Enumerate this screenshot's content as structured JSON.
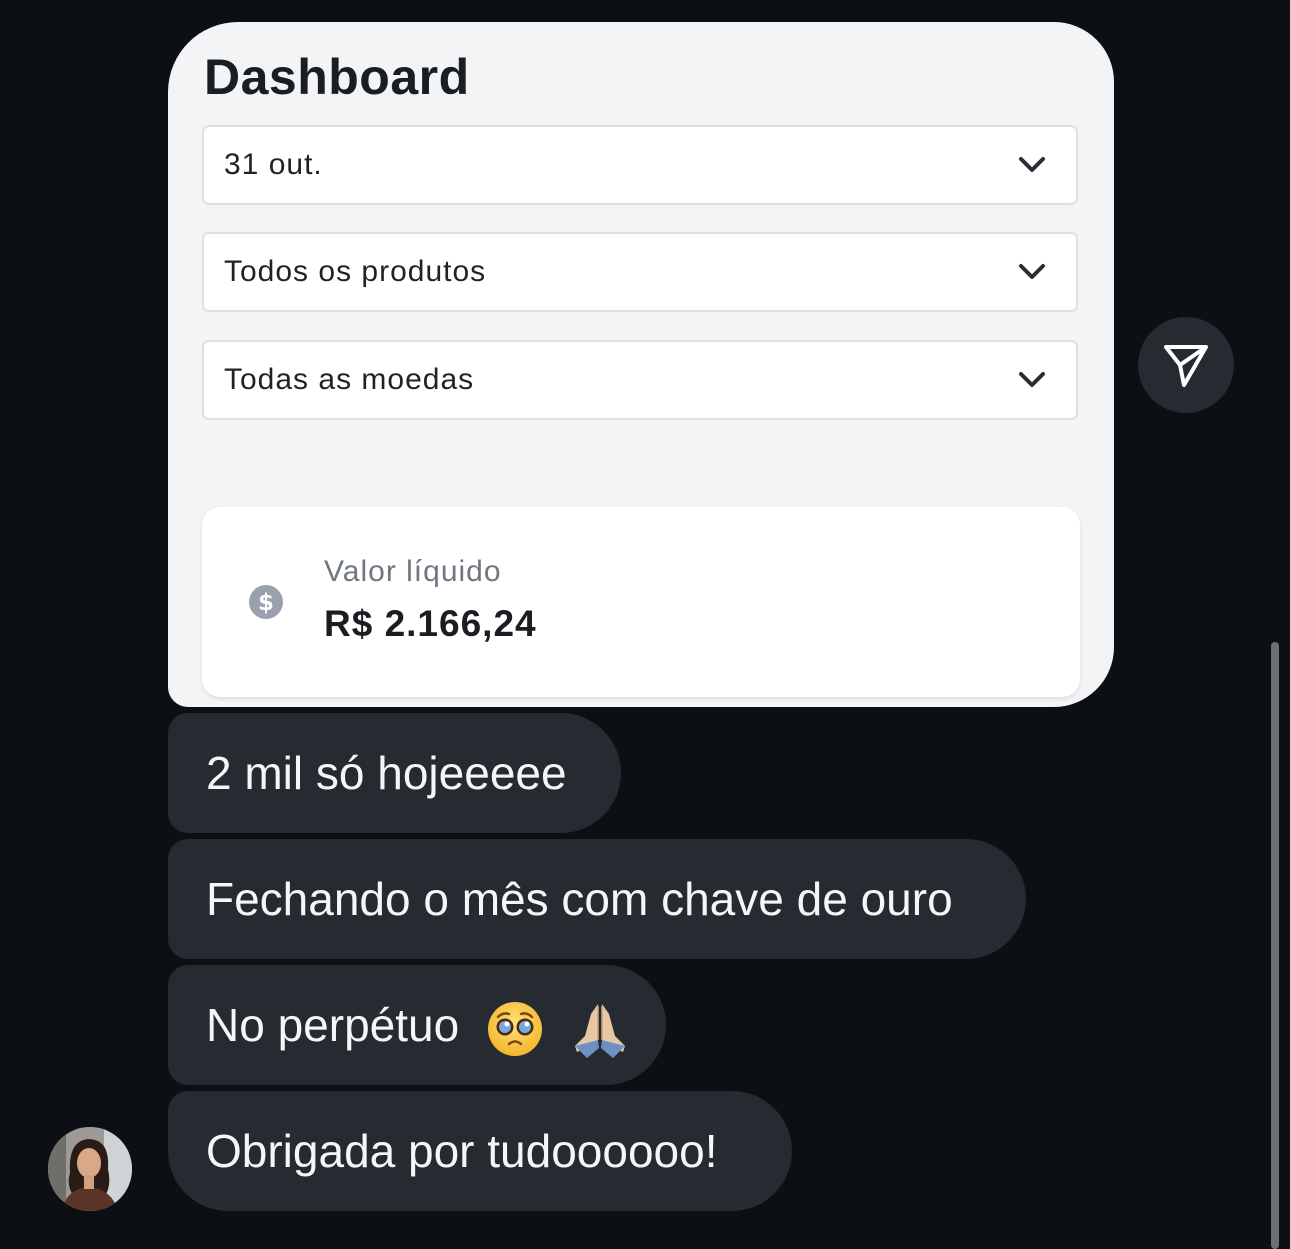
{
  "card": {
    "title": "Dashboard",
    "filters": [
      {
        "value": "31 out."
      },
      {
        "value": "Todos os produtos"
      },
      {
        "value": "Todas as moedas"
      }
    ],
    "metric": {
      "label": "Valor líquido",
      "amount": "R$ 2.166,24"
    }
  },
  "messages": [
    {
      "text": "2 mil só hojeeeee"
    },
    {
      "text": "Fechando o mês com chave de ouro"
    },
    {
      "text": "No perpétuo"
    },
    {
      "text": "Obrigada por tudoooooo!"
    }
  ],
  "icons": {
    "share": "paper-plane-icon",
    "chevron": "chevron-down-icon",
    "dollar": "dollar-circle-icon",
    "emoji_1": "pleading-face-emoji",
    "emoji_2": "folded-hands-emoji"
  },
  "colors": {
    "background": "#0c0f14",
    "bubble": "#262a31",
    "card": "#f3f4f6"
  }
}
